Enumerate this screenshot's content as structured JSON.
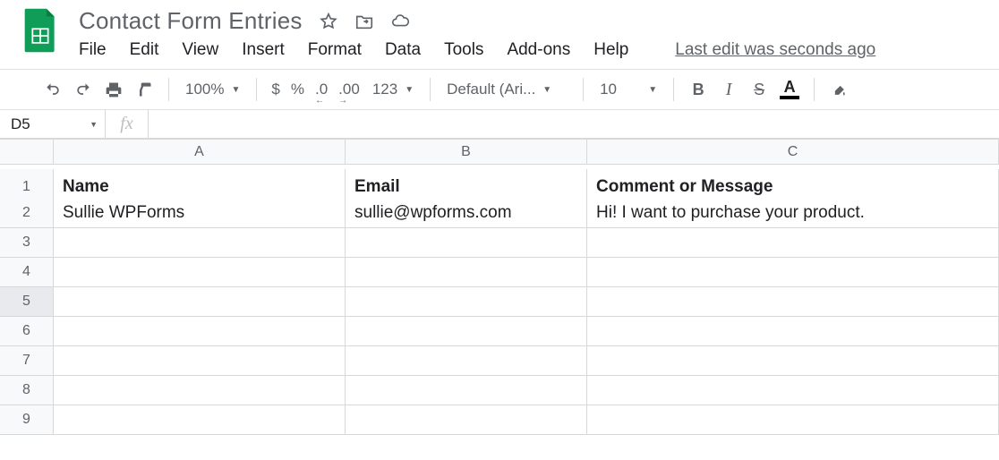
{
  "title": "Contact Form Entries",
  "menu": [
    "File",
    "Edit",
    "View",
    "Insert",
    "Format",
    "Data",
    "Tools",
    "Add-ons",
    "Help"
  ],
  "last_edit": "Last edit was seconds ago",
  "toolbar": {
    "zoom": "100%",
    "currency": "$",
    "percent": "%",
    "dec_dec": ".0",
    "inc_dec": ".00",
    "more_formats": "123",
    "font": "Default (Ari...",
    "font_size": "10",
    "bold": "B",
    "italic": "I",
    "strike": "S",
    "text_color_letter": "A"
  },
  "formula_bar": {
    "name_box": "D5",
    "fx_label": "fx",
    "value": ""
  },
  "columns": [
    "A",
    "B",
    "C"
  ],
  "rows": [
    "1",
    "2",
    "3",
    "4",
    "5",
    "6",
    "7",
    "8",
    "9"
  ],
  "selected_row": "5",
  "data": {
    "headers": [
      "Name",
      "Email",
      "Comment or Message"
    ],
    "row2": [
      "Sullie WPForms",
      "sullie@wpforms.com",
      "Hi! I want to purchase your product."
    ]
  }
}
